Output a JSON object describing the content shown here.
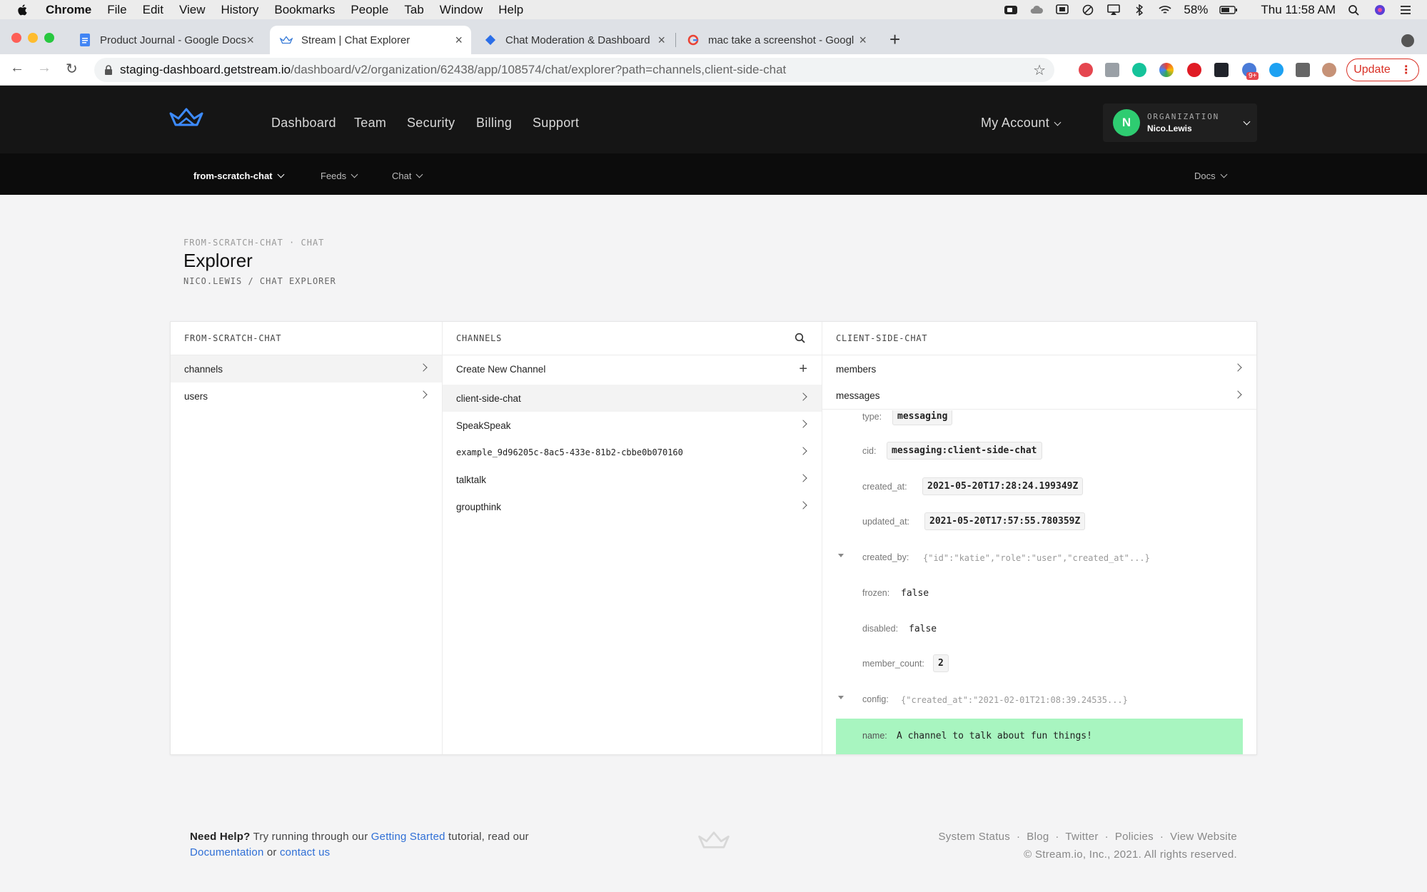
{
  "menubar": {
    "app": "Chrome",
    "items": [
      "File",
      "Edit",
      "View",
      "History",
      "Bookmarks",
      "People",
      "Tab",
      "Window",
      "Help"
    ],
    "battery": "58%",
    "clock": "Thu 11:58 AM"
  },
  "tabs": [
    {
      "title": "Product Journal - Google Docs"
    },
    {
      "title": "Stream | Chat Explorer"
    },
    {
      "title": "Chat Moderation & Dashboard"
    },
    {
      "title": "mac take a screenshot - Googl"
    }
  ],
  "address": {
    "host": "staging-dashboard.getstream.io",
    "path": "/dashboard/v2/organization/62438/app/108574/chat/explorer?path=channels,client-side-chat"
  },
  "browser": {
    "update_label": "Update",
    "ext_badge": "9+"
  },
  "header": {
    "nav": [
      "Dashboard",
      "Team",
      "Security",
      "Billing",
      "Support"
    ],
    "my_account": "My Account",
    "org_label": "ORGANIZATION",
    "org_user": "Nico.Lewis",
    "avatar_letter": "N"
  },
  "subnav": {
    "app": "from-scratch-chat",
    "feeds": "Feeds",
    "chat": "Chat",
    "docs": "Docs"
  },
  "page": {
    "eyebrow": "FROM-SCRATCH-CHAT · CHAT",
    "title": "Explorer",
    "breadcrumb": "NICO.LEWIS / CHAT EXPLORER"
  },
  "explorer": {
    "col1": {
      "header": "FROM-SCRATCH-CHAT",
      "items": [
        "channels",
        "users"
      ]
    },
    "col2": {
      "header": "CHANNELS",
      "create": "Create New Channel",
      "items": [
        "client-side-chat",
        "SpeakSpeak",
        "example_9d96205c-8ac5-433e-81b2-cbbe0b070160",
        "talktalk",
        "groupthink"
      ]
    },
    "col3": {
      "header": "CLIENT-SIDE-CHAT",
      "links": [
        "members",
        "messages"
      ],
      "fields": [
        {
          "key": "type:",
          "value": "messaging"
        },
        {
          "key": "cid:",
          "value": "messaging:client-side-chat"
        },
        {
          "key": "created_at:",
          "value": "2021-05-20T17:28:24.199349Z"
        },
        {
          "key": "updated_at:",
          "value": "2021-05-20T17:57:55.780359Z"
        },
        {
          "key": "created_by:",
          "value": "{\"id\":\"katie\",\"role\":\"user\",\"created_at\"...}"
        },
        {
          "key": "frozen:",
          "value": "false"
        },
        {
          "key": "disabled:",
          "value": "false"
        },
        {
          "key": "member_count:",
          "value": "2"
        },
        {
          "key": "config:",
          "value": "{\"created_at\":\"2021-02-01T21:08:39.24535...}"
        },
        {
          "key": "name:",
          "value": "A channel to talk about fun things!"
        }
      ]
    }
  },
  "footer": {
    "need_help": "Need Help?",
    "text1": " Try running through our ",
    "getting_started": "Getting Started",
    "text2": " tutorial, read our",
    "documentation": "Documentation",
    "or": " or ",
    "contact": "contact us",
    "links": "System Status  ·  Blog  ·  Twitter  ·  Policies  ·  View Website",
    "copyright": "© Stream.io, Inc., 2021. All rights reserved."
  }
}
